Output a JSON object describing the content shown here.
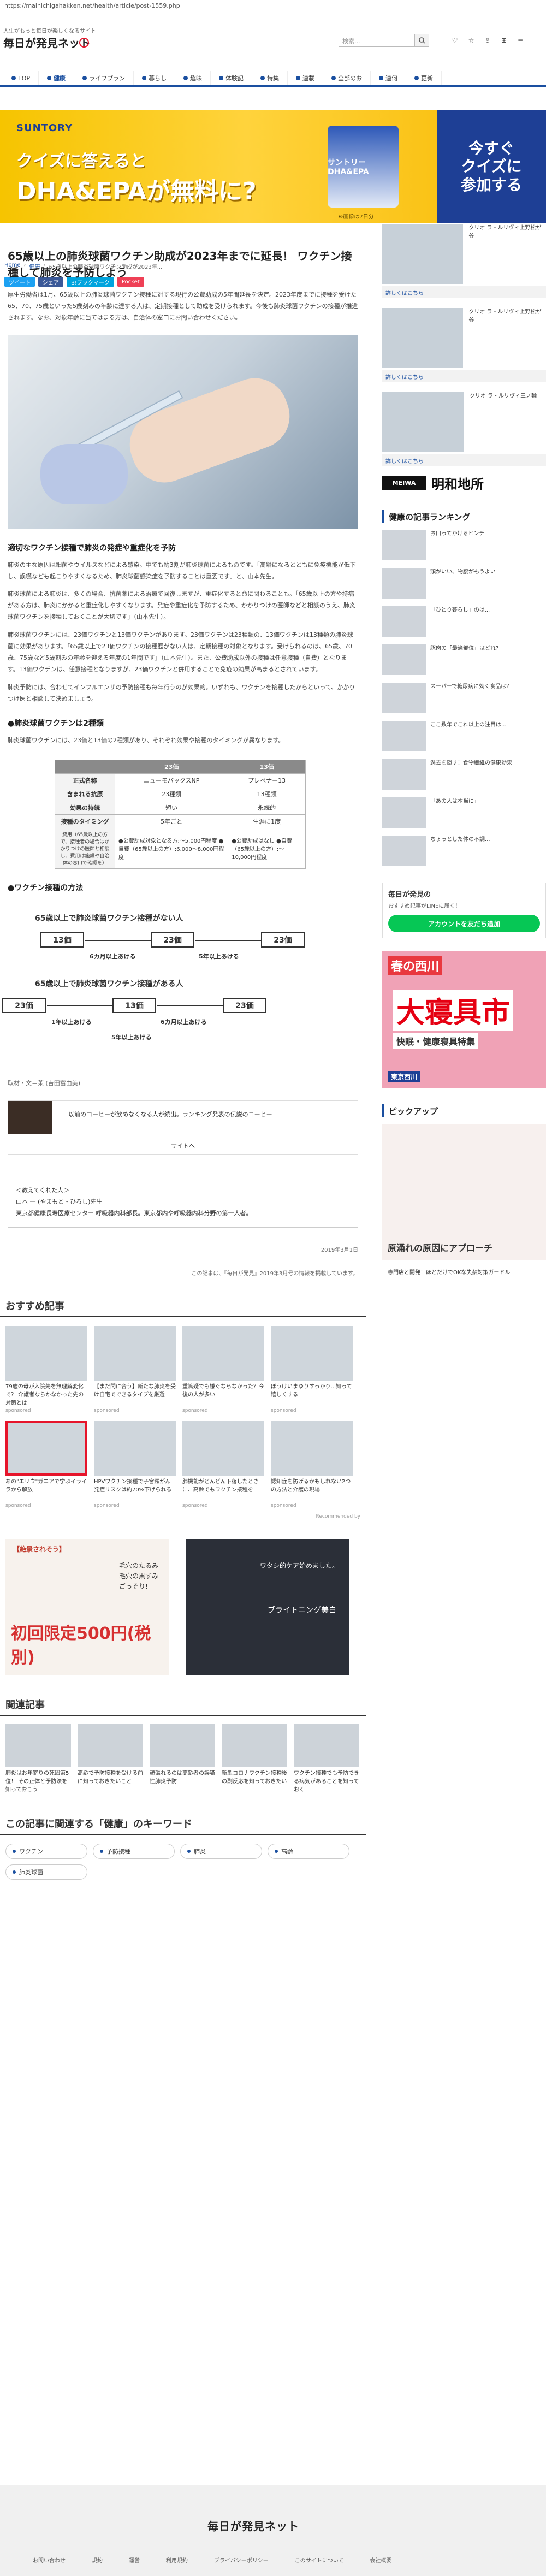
{
  "url": "https://mainichigahakken.net/health/article/post-1559.php",
  "header": {
    "tagline": "人生がもっと毎日が楽しくなるサイト",
    "logo": "毎日が発見ネット",
    "search_placeholder": "検索...",
    "icons": [
      "search-icon",
      "heart-icon",
      "star-icon",
      "share-icon"
    ]
  },
  "nav": [
    {
      "label": "TOP",
      "active": false
    },
    {
      "label": "健康",
      "active": true
    },
    {
      "label": "ライフプラン",
      "active": false
    },
    {
      "label": "暮らし",
      "active": false
    },
    {
      "label": "趣味",
      "active": false
    },
    {
      "label": "体験記",
      "active": false
    },
    {
      "label": "特集",
      "active": false
    },
    {
      "label": "連載",
      "active": false
    },
    {
      "label": "全部のお",
      "active": false
    },
    {
      "label": "連何",
      "active": false
    },
    {
      "label": "更新",
      "active": false
    }
  ],
  "banner": {
    "brand": "SUNTORY",
    "headline": "クイズに答えると",
    "headline2": "DHA&EPAが無料に?",
    "product": "サントリー DHA&EPA",
    "note": "※画像は7日分",
    "cta": [
      "今すぐ",
      "クイズに",
      "参加する"
    ]
  },
  "breadcrumb": [
    "Home",
    "健康",
    "65歳以上の肺炎球菌ワクチン助成が2023年..."
  ],
  "share": [
    "ツイート",
    "シェア",
    "B!ブックマーク",
    "Pocket"
  ],
  "article": {
    "title": "65歳以上の肺炎球菌ワクチン助成が2023年までに延長！ ワクチン接種して肺炎を予防しよう",
    "intro": "厚生労働省は1月、65歳以上の肺炎球菌ワクチン接種に対する現行の公費助成の5年間延長を決定。2023年度までに接種を受けた65、70、75歳といった5歳刻みの年齢に達する人は、定期接種として助成を受けられます。今後も肺炎球菌ワクチンの接種が推進されます。なお、対象年齢に当てはまる方は、自治体の窓口にお問い合わせください。",
    "sec1": "適切なワクチン接種で肺炎の発症や重症化を予防",
    "p1": "肺炎の主な原因は細菌やウイルスなどによる感染。中でも約3割が肺炎球菌によるものです。「高齢になるとともに免疫機能が低下し、誤嚥なども起こりやすくなるため、肺炎球菌感染症を予防することは重要です」と、山本先生。",
    "p2": "肺炎球菌による肺炎は、多くの場合、抗菌薬による治療で回復しますが、重症化すると命に関わることも。「65歳以上の方や持病がある方は、肺炎にかかると重症化しやすくなります。発症や重症化を予防するため、かかりつけの医師などと相談のうえ、肺炎球菌ワクチンを接種しておくことが大切です」（山本先生）。",
    "p3": "肺炎球菌ワクチンには、23価ワクチンと13価ワクチンがあります。23価ワクチンは23種類の、13価ワクチンは13種類の肺炎球菌に効果があります。「65歳以上で23価ワクチンの接種歴がない人は、定期接種の対象となります。受けられるのは、65歳、70歳、75歳など5歳刻みの年齢を迎える年度の1年間です」（山本先生）。また、公費助成以外の接種は任意接種（自費）となります。13価ワクチンは、任意接種となりますが、23価ワクチンと併用することで免疫の効果が高まるとされています。",
    "p4": "肺炎予防には、合わせてインフルエンザの予防接種も毎年行うのが効果的。いずれも、ワクチンを接種したからといって、かかりつけ医と相談して決めましょう。",
    "sec2": "●肺炎球菌ワクチンは2種類",
    "p5": "肺炎球菌ワクチンには、23価と13価の2種類があり、それぞれ効果や接種のタイミングが異なります。",
    "table": {
      "headers": [
        "",
        "23価",
        "13価"
      ],
      "subheaders": [
        "正式名称",
        "ニューモバックスNP",
        "プレベナー13"
      ],
      "rows": [
        [
          "含まれる抗原",
          "23種類",
          "13種類"
        ],
        [
          "効果の持続",
          "短い",
          "永続的"
        ],
        [
          "接種のタイミング",
          "5年ごと",
          "生涯に1度"
        ],
        [
          "費用",
          "●公費助成対象となる方:〜5,000円程度 ●自費（65歳以上の方）:6,000〜8,000円程度",
          "●公費助成はなし ●自費（65歳以上の方）:〜10,000円程度"
        ]
      ],
      "fee_note": "費用（65歳以上の方で、接種者の場合はかかりつけの医師と相談し、費用は施設や自治体の窓口で確認を）"
    },
    "sec3": "●ワクチン接種の方法",
    "diagram": {
      "title1": "65歳以上で肺炎球菌ワクチン接種がない人",
      "title2": "65歳以上で肺炎球菌ワクチン接種がある人",
      "boxes1": [
        "13価",
        "23価",
        "23価"
      ],
      "labels1": [
        "6カ月以上あける",
        "5年以上あける"
      ],
      "boxes2": [
        "23価",
        "13価",
        "23価"
      ],
      "labels2": [
        "1年以上あける",
        "6カ月以上あける",
        "5年以上あける"
      ]
    },
    "credits": "取材・文＝茉 (吉田富由美)",
    "ad_strip": "以前のコーヒーが飲めなくなる人が続出。ランキング発表の伝説のコーヒー",
    "ad_strip_btn": "サイトへ",
    "profile_head": "＜教えてくれた人＞",
    "profile_name": "山本 一 (やまもと・ひろし)先生",
    "profile_desc": "東京都健康長寿医療センター 呼吸器内科部長。東京都内や呼吸器内科分野の第一人者。",
    "date": "2019年3月1日",
    "source": "この記事は、『毎日が発見』2019年3月号の情報を掲載しています。"
  },
  "recommended": {
    "title": "おすすめ記事",
    "items": [
      {
        "text": "79歳の母が入院先を無理解変化で？ 介護者ならかなかった先の対策とは",
        "src": "sponsored"
      },
      {
        "text": "【まだ間に合う】新たな肺炎を受け自宅でできるタイプを厳選",
        "src": "sponsored"
      },
      {
        "text": "重篤疑でも嫌ぐならなかった？今後の人が多い",
        "src": "sponsored"
      },
      {
        "text": "ぼうけいまゆりすっかり...知って嬉しくする",
        "src": "sponsored"
      },
      {
        "text": "あの\"エリウ\"ガニアで学ぶイライラから解放",
        "src": "sponsored"
      },
      {
        "text": "HPVワクチン接種で子宮頸がん発症リスクは約70%下げられる",
        "src": "sponsored"
      },
      {
        "text": "肺機能がどんどん下落したときに、高齢でもワクチン接種を",
        "src": "sponsored"
      },
      {
        "text": "認知症を防げるかもしれない2つの方法と介護の現場",
        "src": "sponsored"
      }
    ],
    "pr": "Recommended by"
  },
  "ads": {
    "a_head": "【絶景されそう】",
    "a_price": "初回限定500円(税別)",
    "a_lines": [
      "毛穴のたるみ",
      "毛穴の黒ずみ",
      "ごっそり!"
    ],
    "b_brand": "ブライトニング美白",
    "b_line": "ワタシ的ケア始めました。"
  },
  "related": {
    "title": "関連記事",
    "items": [
      {
        "text": "肺炎はお年寄りの死因第5位！ その正体と予防法を知っておこう"
      },
      {
        "text": "高齢で予防接種を受ける前に知っておきたいこと"
      },
      {
        "text": "頑張れるのは高齢者の誤嚥性肺炎予防"
      },
      {
        "text": "新型コロナワクチン接種後の副反応を知っておきたい"
      },
      {
        "text": "ワクチン接種でも予防できる病気があることを知っておく"
      }
    ]
  },
  "keywords": {
    "title": "この記事に関連する「健康」のキーワード",
    "items": [
      "ワクチン",
      "予防接種",
      "肺炎",
      "高齢",
      "肺炎球菌"
    ]
  },
  "footer": {
    "logo": "毎日が発見ネット",
    "links": [
      "お問い合わせ",
      "規約",
      "運営",
      "利用規約",
      "プライバシーポリシー",
      "このサイトについて",
      "会社概要"
    ]
  },
  "sidebar": {
    "ads": [
      {
        "title": "クリオ ラ・ルリヴィ上野松が谷",
        "more": "詳しくはこちら"
      },
      {
        "title": "クリオ ラ・ルリヴィ上野松が谷",
        "more": "詳しくはこちら"
      },
      {
        "title": "クリオ ラ・ルリヴィ三ノ輪",
        "more": "詳しくはこちら"
      }
    ],
    "meiwa_logo": "MEIWA",
    "meiwa_name": "明和地所",
    "ranking_title": "健康の記事ランキング",
    "ranking": [
      "お口ってかけるヒンチ",
      "頭がいい、物腰がもうよい",
      "「ひとり暮らし」のは...",
      "豚肉の「最適部位」はどれ?",
      "スーパーで糖尿病に効く食品は？",
      "ここ数年でこれ以上の注目は...",
      "過去を隠す！食物繊維の健康効果",
      "「あの人は本当に」",
      "ちょっとした体の不調..."
    ],
    "line_title": "毎日が発見の",
    "line_sub": "おすすめ記事がLINEに届く！",
    "line_btn": "アカウントを友だち追加",
    "banner_head": "春の西川",
    "banner_big": "大寝具市",
    "banner_sub": "快眠・健康寝具特集",
    "banner_foot": "東京西川",
    "pickup_title": "ピックアップ",
    "pickup_text": "原涌れの原因にアプローチ",
    "pickup_sub": "専門店と開発！ほとだけでOKな失禁対策ガードル"
  }
}
